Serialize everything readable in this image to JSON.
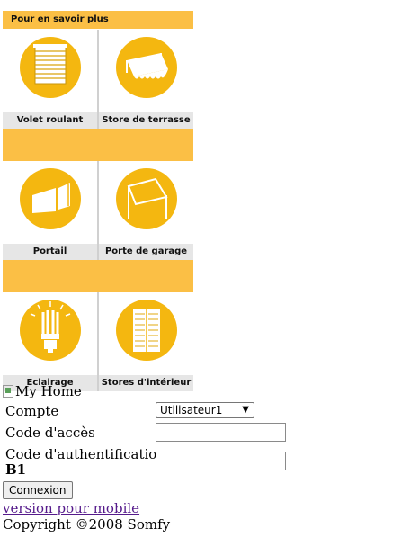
{
  "panel": {
    "header": "Pour en savoir plus",
    "rows": [
      [
        {
          "label": "Volet roulant",
          "icon": "roller-shutter-icon"
        },
        {
          "label": "Store de terrasse",
          "icon": "terrace-awning-icon"
        }
      ],
      [
        {
          "label": "Portail",
          "icon": "gate-icon"
        },
        {
          "label": "Porte de garage",
          "icon": "garage-door-icon"
        }
      ],
      [
        {
          "label": "Eclairage",
          "icon": "light-bulb-icon"
        },
        {
          "label": "Stores d'intérieur",
          "icon": "interior-blinds-icon"
        }
      ]
    ],
    "accent": "#fbbf45",
    "circle_color": "#f4b710"
  },
  "logo_alt": "My Home",
  "form": {
    "account_label": "Compte",
    "account_value": "Utilisateur1",
    "access_code_label": "Code d'accès",
    "auth_code_label": "Code d'authentification",
    "auth_code_hint": "B1",
    "submit_label": "Connexion"
  },
  "footer": {
    "mobile_link": "version pour mobile",
    "copyright": "Copyright ©2008 Somfy"
  }
}
